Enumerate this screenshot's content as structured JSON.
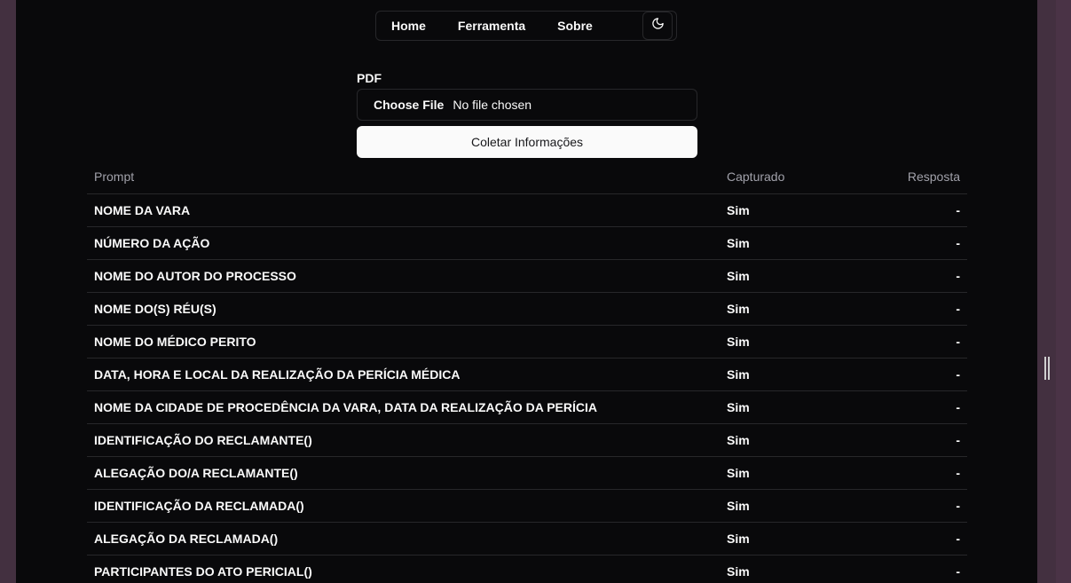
{
  "nav": {
    "items": [
      {
        "label": "Home"
      },
      {
        "label": "Ferramenta"
      },
      {
        "label": "Sobre"
      }
    ],
    "theme_icon": "moon-icon"
  },
  "form": {
    "label": "PDF",
    "file_button": "Choose File",
    "file_status": "No file chosen",
    "submit_label": "Coletar Informações"
  },
  "table": {
    "headers": {
      "prompt": "Prompt",
      "capturado": "Capturado",
      "resposta": "Resposta"
    },
    "rows": [
      {
        "prompt": "NOME DA VARA",
        "capturado": "Sim",
        "resposta": "-"
      },
      {
        "prompt": "NÚMERO DA AÇÃO",
        "capturado": "Sim",
        "resposta": "-"
      },
      {
        "prompt": "NOME DO AUTOR DO PROCESSO",
        "capturado": "Sim",
        "resposta": "-"
      },
      {
        "prompt": "NOME DO(S) RÉU(S)",
        "capturado": "Sim",
        "resposta": "-"
      },
      {
        "prompt": "NOME DO MÉDICO PERITO",
        "capturado": "Sim",
        "resposta": "-"
      },
      {
        "prompt": "DATA, HORA E LOCAL DA REALIZAÇÃO DA PERÍCIA MÉDICA",
        "capturado": "Sim",
        "resposta": "-"
      },
      {
        "prompt": "NOME DA CIDADE DE PROCEDÊNCIA DA VARA, DATA DA REALIZAÇÃO DA PERÍCIA",
        "capturado": "Sim",
        "resposta": "-"
      },
      {
        "prompt": "IDENTIFICAÇÃO DO RECLAMANTE()",
        "capturado": "Sim",
        "resposta": "-"
      },
      {
        "prompt": "ALEGAÇÃO DO/A RECLAMANTE()",
        "capturado": "Sim",
        "resposta": "-"
      },
      {
        "prompt": "IDENTIFICAÇÃO DA RECLAMADA()",
        "capturado": "Sim",
        "resposta": "-"
      },
      {
        "prompt": "ALEGAÇÃO DA RECLAMADA()",
        "capturado": "Sim",
        "resposta": "-"
      },
      {
        "prompt": "PARTICIPANTES DO ATO PERICIAL()",
        "capturado": "Sim",
        "resposta": "-"
      }
    ]
  }
}
